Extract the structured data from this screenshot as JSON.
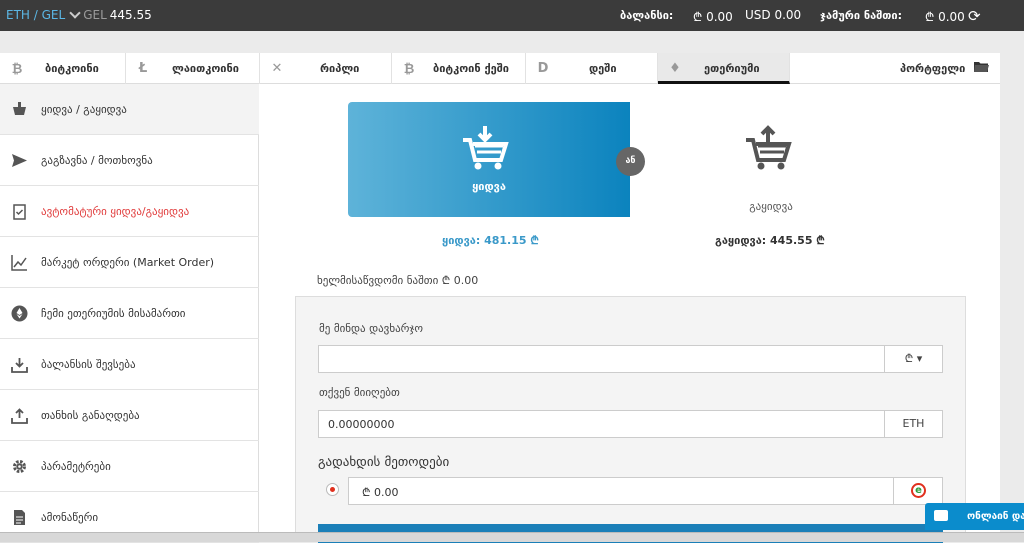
{
  "topbar": {
    "pair_eth": "ETH",
    "pair_sep": " / ",
    "pair_gel": "GEL",
    "gel_label": "GEL",
    "gel_rate": "445.55",
    "balance_label": "ბალანსი:",
    "balance_gel": "₾ 0.00",
    "balance_usd": "USD 0.00",
    "total_label": "ჯამური ნაშთი:",
    "total_value": "₾ 0.00"
  },
  "tabs": [
    {
      "label": "ბიტკოინი",
      "icon": "bitcoin-icon",
      "glyph": "₿"
    },
    {
      "label": "ლაითკოინი",
      "icon": "litecoin-icon",
      "glyph": "Ł"
    },
    {
      "label": "რიპლი",
      "icon": "ripple-icon",
      "glyph": "✕"
    },
    {
      "label": "ბიტკოინ ქეში",
      "icon": "bitcoin-cash-icon",
      "glyph": "₿"
    },
    {
      "label": "დეში",
      "icon": "dash-icon",
      "glyph": "D"
    },
    {
      "label": "ეთერიუმი",
      "icon": "ethereum-icon",
      "glyph": "♦"
    },
    {
      "label": "პორტფელი",
      "icon": "folder-icon",
      "glyph": "▬"
    }
  ],
  "sidebar": {
    "items": [
      {
        "label": "ყიდვა / გაყიდვა",
        "icon": "basket-icon",
        "glyph": "🧺"
      },
      {
        "label": "გაგზავნა / მოთხოვნა",
        "icon": "send-icon",
        "glyph": "➤"
      },
      {
        "label": "ავტომატური ყიდვა/გაყიდვა",
        "icon": "clipboard-check-icon",
        "glyph": "☑"
      },
      {
        "label": "მარკეტ ორდერი (Market Order)",
        "icon": "chart-line-icon",
        "glyph": "📈"
      },
      {
        "label": "ჩემი ეთერიუმის მისამართი",
        "icon": "ethereum-icon",
        "glyph": "♦"
      },
      {
        "label": "ბალანსის შევსება",
        "icon": "download-tray-icon",
        "glyph": "⤓"
      },
      {
        "label": "თანხის განაღდება",
        "icon": "upload-tray-icon",
        "glyph": "⤒"
      },
      {
        "label": "პარამეტრები",
        "icon": "gear-icon",
        "glyph": "⚙"
      },
      {
        "label": "ამონაწერი",
        "icon": "document-icon",
        "glyph": "▤"
      }
    ]
  },
  "trade": {
    "buy_label": "ყიდვა",
    "or_label": "ან",
    "sell_label": "გაყიდვა",
    "buy_price": "ყიდვა: 481.15 ₾",
    "sell_price": "გაყიდვა: 445.55 ₾",
    "available": "ხელმისაწვდომი ნაშთი  ₾ 0.00"
  },
  "form": {
    "spend_label": "მე მინდა დავხარჯო",
    "spend_value": "",
    "spend_currency": "₾ ▾",
    "receive_label": "თქვენ მიიღებთ",
    "receive_value": "0.00000000",
    "receive_currency": "ETH",
    "payment_title": "გადახდის მეთოდები",
    "payment_value": "₾ 0.00",
    "payment_icon": "e-money-icon"
  },
  "chat": {
    "label": "ონლაინ დახ"
  },
  "colors": {
    "topbar": "#3b3b3b",
    "accent": "#0b83be",
    "red": "#e03a3a"
  }
}
